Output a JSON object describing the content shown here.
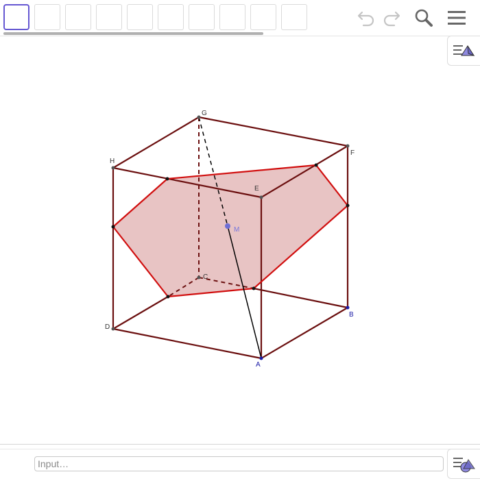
{
  "toolbar": {
    "tools": [
      {
        "name": "move",
        "active": true
      },
      {
        "name": "point",
        "active": false
      },
      {
        "name": "segment",
        "active": false
      },
      {
        "name": "polygon",
        "active": false
      },
      {
        "name": "plane",
        "active": false
      },
      {
        "name": "pyramid",
        "active": false
      },
      {
        "name": "sphere",
        "active": false
      },
      {
        "name": "rotate-view",
        "active": false
      },
      {
        "name": "net",
        "active": false
      },
      {
        "name": "view-in-front",
        "active": false
      }
    ],
    "undo_icon": "undo-icon",
    "redo_icon": "redo-icon",
    "search_icon": "search-icon",
    "menu_icon": "menu-icon"
  },
  "graphics_style_icon": "graphics-style-icon",
  "scene": {
    "points": {
      "A": {
        "label": "A",
        "color": "#1a1aa6"
      },
      "B": {
        "label": "B",
        "color": "#1a1aa6"
      },
      "C": {
        "label": "C",
        "color": "#333333"
      },
      "D": {
        "label": "D",
        "color": "#333333"
      },
      "E": {
        "label": "E",
        "color": "#333333"
      },
      "F": {
        "label": "F",
        "color": "#333333"
      },
      "G": {
        "label": "G",
        "color": "#333333"
      },
      "H": {
        "label": "H",
        "color": "#333333"
      },
      "M": {
        "label": "M",
        "color": "#7777dd"
      }
    },
    "colors": {
      "cube_edge": "#6b0f0f",
      "section_edge": "#d10f0f",
      "section_fill": "#e8c4c4",
      "diagonal": "#000000"
    }
  },
  "algebra_input": {
    "placeholder": "Input…",
    "value": ""
  }
}
